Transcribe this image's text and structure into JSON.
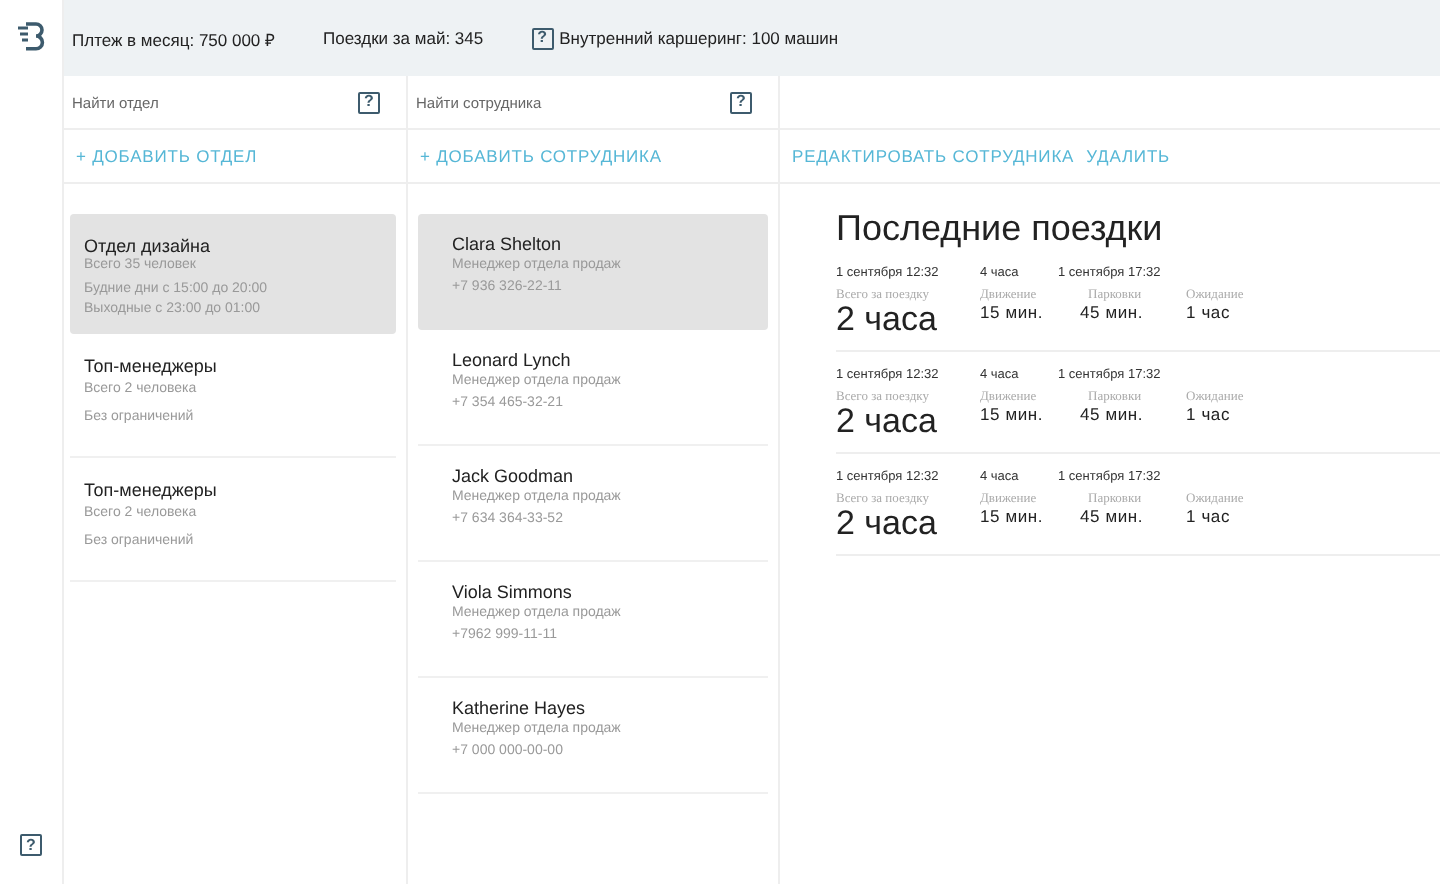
{
  "topbar": {
    "stats": [
      {
        "text": "Плтеж в месяц: 750 000 ₽"
      },
      {
        "text": "Поездки за май: 345"
      },
      {
        "help": "?",
        "text": "Внутренний каршеринг: 100 машин"
      }
    ]
  },
  "search_help": "?",
  "departments": {
    "search": {
      "placeholder": "Найти отдел"
    },
    "add": "+ ДОБАВИТЬ ОТДЕЛ",
    "items": [
      {
        "name": "Отдел дизайна",
        "count": "Всего 35 человек",
        "schedule": [
          "Будние дни с 15:00 до 20:00",
          "Выходные с 23:00 до 01:00"
        ],
        "selected": true
      },
      {
        "name": "Топ-менеджеры",
        "count": "Всего 2 человека",
        "schedule": [
          "Без ограничений"
        ],
        "selected": false
      },
      {
        "name": "Топ-менеджеры",
        "count": "Всего 2 человека",
        "schedule": [
          "Без ограничений"
        ],
        "selected": false
      }
    ]
  },
  "employees": {
    "search": {
      "placeholder": "Найти сотрудника"
    },
    "add": "+ ДОБАВИТЬ СОТРУДНИКА",
    "items": [
      {
        "name": "Clara Shelton",
        "role": "Менеджер отдела продаж",
        "phone": "+7 936 326-22-11",
        "selected": true
      },
      {
        "name": "Leonard Lynch",
        "role": "Менеджер отдела продаж",
        "phone": "+7 354 465-32-21",
        "selected": false
      },
      {
        "name": "Jack Goodman",
        "role": "Менеджер отдела продаж",
        "phone": "+7 634 364-33-52",
        "selected": false
      },
      {
        "name": "Viola Simmons",
        "role": "Менеджер отдела продаж",
        "phone": "+7962 999-11-11",
        "selected": false
      },
      {
        "name": "Katherine Hayes",
        "role": "Менеджер отдела продаж",
        "phone": "+7 000 000-00-00",
        "selected": false
      }
    ]
  },
  "details": {
    "actions": [
      "РЕДАКТИРОВАТЬ СОТРУДНИКА",
      "УДАЛИТЬ"
    ],
    "title": "Последние поездки",
    "trips": [
      {
        "start": "1 сентября 12:32",
        "duration": "4 часа",
        "end": "1 сентября 17:32",
        "total_label": "Всего за поездку",
        "total": "2 часа",
        "stats": [
          {
            "label": "Движение",
            "value": "15 мин."
          },
          {
            "label": "Парковки",
            "value": "45 мин."
          },
          {
            "label": "Ожидание",
            "value": "1 час"
          }
        ]
      },
      {
        "start": "1 сентября 12:32",
        "duration": "4 часа",
        "end": "1 сентября 17:32",
        "total_label": "Всего за поездку",
        "total": "2 часа",
        "stats": [
          {
            "label": "Движение",
            "value": "15 мин."
          },
          {
            "label": "Парковки",
            "value": "45 мин."
          },
          {
            "label": "Ожидание",
            "value": "1 час"
          }
        ]
      },
      {
        "start": "1 сентября 12:32",
        "duration": "4 часа",
        "end": "1 сентября 17:32",
        "total_label": "Всего за поездку",
        "total": "2 часа",
        "stats": [
          {
            "label": "Движение",
            "value": "15 мин."
          },
          {
            "label": "Парковки",
            "value": "45 мин."
          },
          {
            "label": "Ожидание",
            "value": "1 час"
          }
        ]
      }
    ]
  },
  "rail": {
    "help": "?"
  }
}
